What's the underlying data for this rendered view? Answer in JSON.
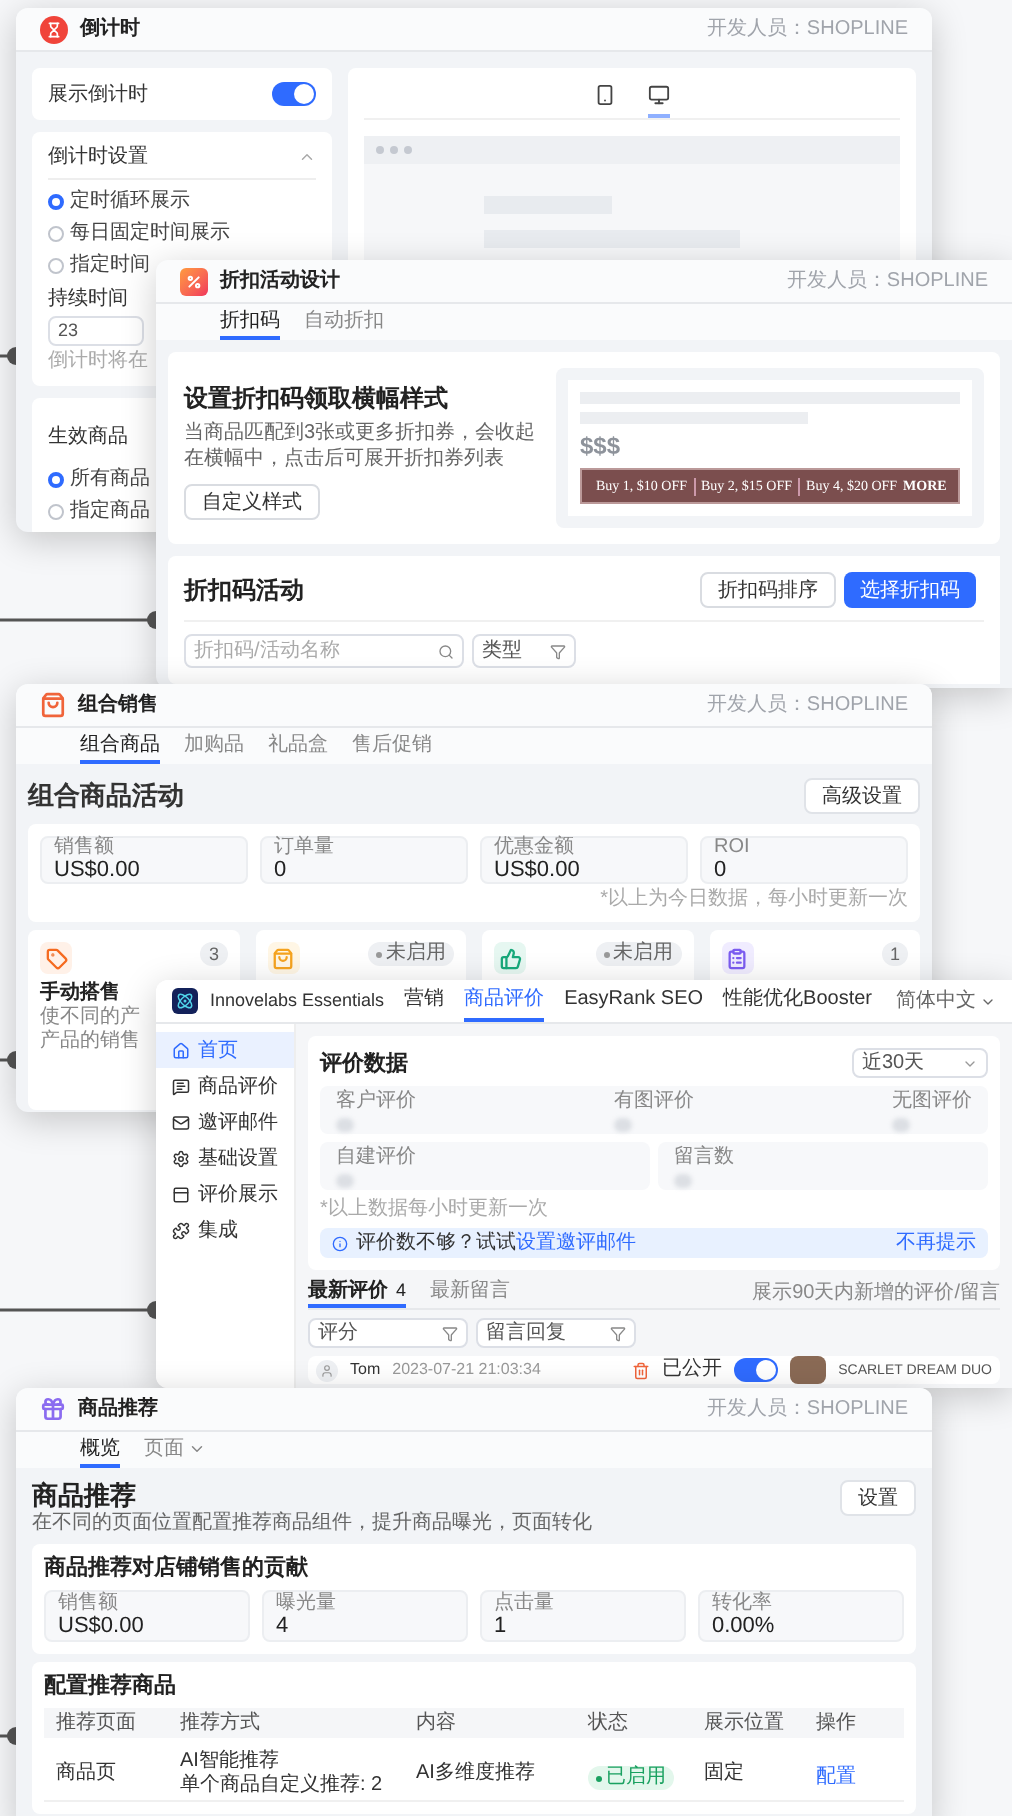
{
  "countdown_window": {
    "title": "倒计时",
    "developer": "开发人员：SHOPLINE",
    "show_toggle": {
      "label": "展示倒计时",
      "on": true
    },
    "settings": {
      "title": "倒计时设置",
      "expanded": true,
      "options": [
        {
          "label": "定时循环展示",
          "selected": true
        },
        {
          "label": "每日固定时间展示",
          "selected": false
        },
        {
          "label": "指定时间",
          "selected": false
        }
      ],
      "duration_label": "持续时间",
      "duration_value": "23",
      "hint": "倒计时将在"
    },
    "products": {
      "title": "生效商品",
      "options": [
        {
          "label": "所有商品",
          "selected": true
        },
        {
          "label": "指定商品",
          "selected": false
        }
      ]
    },
    "preview_devices": [
      {
        "kind": "mobile",
        "selected": false
      },
      {
        "kind": "desktop",
        "selected": true
      }
    ]
  },
  "discount_window": {
    "title": "折扣活动设计",
    "developer": "开发人员：SHOPLINE",
    "tabs": [
      {
        "label": "折扣码",
        "selected": true
      },
      {
        "label": "自动折扣",
        "selected": false
      }
    ],
    "banner_card": {
      "title": "设置折扣码领取横幅样式",
      "description": "当商品匹配到3张或更多折扣券，会收起在横幅中，点击后可展开折扣券列表",
      "button": "自定义样式",
      "preview": {
        "price": "$$$",
        "offers": [
          "Buy 1, $10 OFF",
          "Buy 2, $15 OFF",
          "Buy 4, $20 OFF"
        ],
        "more": "MORE"
      }
    },
    "codes_card": {
      "title": "折扣码活动",
      "buttons": [
        {
          "label": "折扣码排序",
          "kind": "secondary"
        },
        {
          "label": "选择折扣码",
          "kind": "primary"
        }
      ],
      "search_placeholder": "折扣码/活动名称",
      "type_filter": "类型"
    }
  },
  "bundle_window": {
    "title": "组合销售",
    "developer": "开发人员：SHOPLINE",
    "tabs": [
      {
        "label": "组合商品",
        "selected": true
      },
      {
        "label": "加购品",
        "selected": false
      },
      {
        "label": "礼品盒",
        "selected": false
      },
      {
        "label": "售后促销",
        "selected": false
      }
    ],
    "heading": "组合商品活动",
    "button": "高级设置",
    "stats": [
      {
        "label": "销售额",
        "value": "US$0.00"
      },
      {
        "label": "订单量",
        "value": "0"
      },
      {
        "label": "优惠金额",
        "value": "US$0.00"
      },
      {
        "label": "ROI",
        "value": "0"
      }
    ],
    "note": "*以上为今日数据，每小时更新一次",
    "cards": [
      {
        "kind": "tag",
        "badge": {
          "kind": "count",
          "text": "3"
        },
        "title": "手动搭售",
        "lines": [
          "使不同的产",
          "产品的销售"
        ]
      },
      {
        "kind": "bag",
        "badge": {
          "kind": "status",
          "text": "未启用"
        }
      },
      {
        "kind": "thumb",
        "badge": {
          "kind": "status",
          "text": "未启用"
        }
      },
      {
        "kind": "clipboard",
        "badge": {
          "kind": "count",
          "text": "1"
        }
      }
    ]
  },
  "reviews_window": {
    "brand": "Innovelabs Essentials",
    "nav": [
      {
        "label": "营销",
        "selected": false
      },
      {
        "label": "商品评价",
        "selected": true
      },
      {
        "label": "EasyRank SEO",
        "selected": false
      },
      {
        "label": "性能优化Booster",
        "selected": false
      }
    ],
    "language": "简体中文",
    "sidebar": [
      {
        "kind": "home",
        "label": "首页",
        "selected": true
      },
      {
        "kind": "review",
        "label": "商品评价",
        "selected": false
      },
      {
        "kind": "mail",
        "label": "邀评邮件",
        "selected": false
      },
      {
        "kind": "settings",
        "label": "基础设置",
        "selected": false
      },
      {
        "kind": "display",
        "label": "评价展示",
        "selected": false
      },
      {
        "kind": "integration",
        "label": "集成",
        "selected": false
      }
    ],
    "stats_title": "评价数据",
    "range": "近30天",
    "metrics_row_1": [
      "客户评价",
      "有图评价",
      "无图评价"
    ],
    "metrics_row_2": [
      "自建评价",
      "留言数"
    ],
    "note": "*以上数据每小时更新一次",
    "tip": {
      "text": "评价数不够？试试",
      "link": "设置邀评邮件",
      "dismiss": "不再提示"
    },
    "tabs": [
      {
        "label": "最新评价",
        "count": "4",
        "selected": true
      },
      {
        "label": "最新留言",
        "selected": false
      }
    ],
    "range_note": "展示90天内新增的评价/留言",
    "filters": [
      "评分",
      "留言回复"
    ],
    "review": {
      "author": "Tom",
      "date": "2023-07-21 21:03:34",
      "public_label": "已公开",
      "public": true,
      "product": "SCARLET DREAM DUO"
    }
  },
  "recommend_window": {
    "title": "商品推荐",
    "developer": "开发人员：SHOPLINE",
    "tabs": [
      {
        "label": "概览",
        "selected": true,
        "dropdown": false
      },
      {
        "label": "页面",
        "selected": false,
        "dropdown": true
      }
    ],
    "heading": "商品推荐",
    "button": "设置",
    "description": "在不同的页面位置配置推荐商品组件，提升商品曝光，页面转化",
    "contribution": {
      "title": "商品推荐对店铺销售的贡献",
      "stats": [
        {
          "label": "销售额",
          "value": "US$0.00"
        },
        {
          "label": "曝光量",
          "value": "4"
        },
        {
          "label": "点击量",
          "value": "1"
        },
        {
          "label": "转化率",
          "value": "0.00%"
        }
      ]
    },
    "config": {
      "title": "配置推荐商品",
      "columns": [
        "推荐页面",
        "推荐方式",
        "内容",
        "状态",
        "展示位置",
        "操作"
      ],
      "rows": [
        {
          "page": "商品页",
          "method": [
            "AI智能推荐",
            "单个商品自定义推荐: 2"
          ],
          "content": "AI多维度推荐",
          "status": "已启用",
          "enabled": true,
          "position": "固定",
          "action": "配置"
        }
      ]
    }
  }
}
